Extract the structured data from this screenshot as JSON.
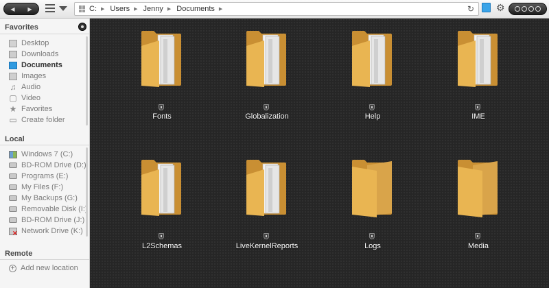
{
  "toolbar": {
    "back_icon": "back-arrow-icon",
    "forward_icon": "forward-arrow-icon",
    "breadcrumbs": [
      "C:",
      "Users",
      "Jenny",
      "Documents"
    ]
  },
  "sidebar": {
    "favorites": {
      "title": "Favorites",
      "items": [
        {
          "label": "Desktop",
          "icon": "desktop-icon"
        },
        {
          "label": "Downloads",
          "icon": "downloads-icon"
        },
        {
          "label": "Documents",
          "icon": "documents-icon",
          "active": true
        },
        {
          "label": "Images",
          "icon": "images-icon"
        },
        {
          "label": "Audio",
          "icon": "music-note-icon"
        },
        {
          "label": "Video",
          "icon": "video-icon"
        },
        {
          "label": "Favorites",
          "icon": "star-icon"
        },
        {
          "label": "Create folder",
          "icon": "folder-icon"
        }
      ]
    },
    "local": {
      "title": "Local",
      "items": [
        {
          "label": "Windows 7 (C:)",
          "icon": "windows-drive-icon"
        },
        {
          "label": "BD-ROM Drive (D:)",
          "icon": "optical-drive-icon"
        },
        {
          "label": "Programs (E:)",
          "icon": "hard-drive-icon"
        },
        {
          "label": "My Files (F:)",
          "icon": "hard-drive-icon"
        },
        {
          "label": "My Backups (G:)",
          "icon": "hard-drive-icon"
        },
        {
          "label": "Removable Disk (I:)",
          "icon": "removable-disk-icon"
        },
        {
          "label": "BD-ROM Drive (J:)",
          "icon": "optical-drive-icon"
        },
        {
          "label": "Network Drive (K:)",
          "icon": "network-drive-icon"
        }
      ]
    },
    "remote": {
      "title": "Remote",
      "items": [
        {
          "label": "Add new location",
          "icon": "add-icon"
        }
      ]
    }
  },
  "folders": [
    {
      "name": "Fonts",
      "style": "documents"
    },
    {
      "name": "Globalization",
      "style": "documents"
    },
    {
      "name": "Help",
      "style": "documents"
    },
    {
      "name": "IME",
      "style": "documents"
    },
    {
      "name": "L2Schemas",
      "style": "documents"
    },
    {
      "name": "LiveKernelReports",
      "style": "documents"
    },
    {
      "name": "Logs",
      "style": "empty"
    },
    {
      "name": "Media",
      "style": "empty"
    }
  ],
  "colors": {
    "folder": "#e9b552",
    "folder_dark": "#c98f33",
    "main_bg": "#262626",
    "documents_accent": "#2f9ae0"
  }
}
